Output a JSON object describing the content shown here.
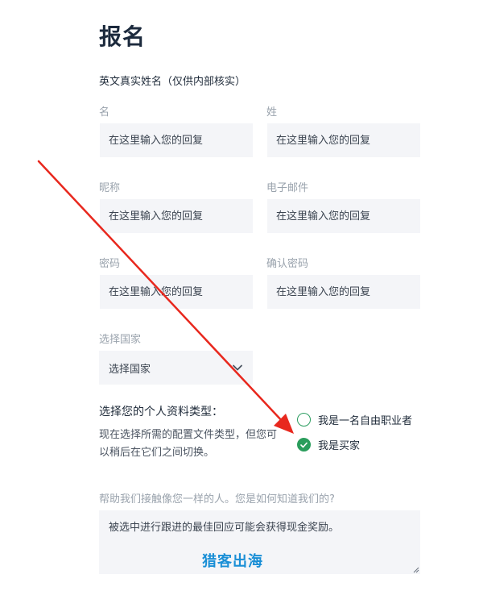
{
  "page": {
    "title": "报名"
  },
  "name_section": {
    "label": "英文真实姓名（仅供内部核实）"
  },
  "fields": {
    "first_name": {
      "label": "名",
      "placeholder": "在这里输入您的回复"
    },
    "last_name": {
      "label": "姓",
      "placeholder": "在这里输入您的回复"
    },
    "nickname": {
      "label": "昵称",
      "placeholder": "在这里输入您的回复"
    },
    "email": {
      "label": "电子邮件",
      "placeholder": "在这里输入您的回复"
    },
    "password": {
      "label": "密码",
      "placeholder": "在这里输入您的回复"
    },
    "confirm_password": {
      "label": "确认密码",
      "placeholder": "在这里输入您的回复"
    }
  },
  "country": {
    "label": "选择国家",
    "selected": "选择国家"
  },
  "profile_type": {
    "question": "选择您的个人资料类型：",
    "description": "现在选择所需的配置文件类型，但您可以稍后在它们之间切换。",
    "options": [
      {
        "label": "我是一名自由职业者",
        "checked": false
      },
      {
        "label": "我是买家",
        "checked": true
      }
    ]
  },
  "referral": {
    "label": "帮助我们接触像您一样的人。您是如何知道我们的?",
    "text": "被选中进行跟进的最佳回应可能会获得现金奖励。"
  },
  "watermark": {
    "text": "猎客出海"
  },
  "colors": {
    "accent_green": "#2a9d5c",
    "annotation_red": "#e8281e",
    "input_bg": "#f4f5f8"
  }
}
